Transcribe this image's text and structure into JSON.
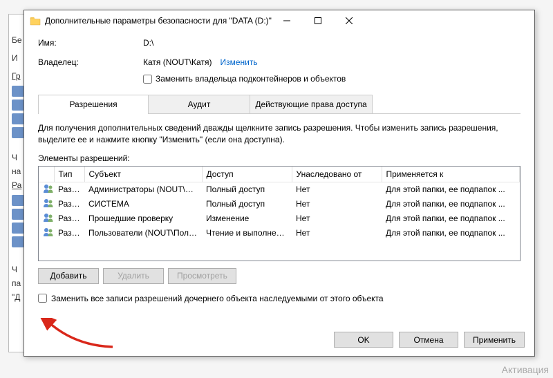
{
  "window": {
    "title": "Дополнительные параметры безопасности  для \"DATA (D:)\""
  },
  "fields": {
    "name_label": "Имя:",
    "name_value": "D:\\",
    "owner_label": "Владелец:",
    "owner_value": "Катя (NOUT\\Катя)",
    "change_link": "Изменить",
    "replace_owner_checkbox": "Заменить владельца подконтейнеров и объектов"
  },
  "tabs": {
    "permissions": "Разрешения",
    "audit": "Аудит",
    "effective": "Действующие права доступа"
  },
  "instructions": "Для получения дополнительных сведений дважды щелкните запись разрешения. Чтобы изменить запись разрешения, выделите ее и нажмите кнопку \"Изменить\" (если она доступна).",
  "section_label": "Элементы разрешений:",
  "columns": {
    "type": "Тип",
    "subject": "Субъект",
    "access": "Доступ",
    "inherited": "Унаследовано от",
    "applies": "Применяется к"
  },
  "rows": [
    {
      "type": "Разр...",
      "subject": "Администраторы (NOUT\\Ад...",
      "access": "Полный доступ",
      "inherited": "Нет",
      "applies": "Для этой папки, ее подпапок ..."
    },
    {
      "type": "Разр...",
      "subject": "СИСТЕМА",
      "access": "Полный доступ",
      "inherited": "Нет",
      "applies": "Для этой папки, ее подпапок ..."
    },
    {
      "type": "Разр...",
      "subject": "Прошедшие проверку",
      "access": "Изменение",
      "inherited": "Нет",
      "applies": "Для этой папки, ее подпапок ..."
    },
    {
      "type": "Разр...",
      "subject": "Пользователи (NOUT\\Польз...",
      "access": "Чтение и выполнение",
      "inherited": "Нет",
      "applies": "Для этой папки, ее подпапок ..."
    }
  ],
  "buttons": {
    "add": "Добавить",
    "remove": "Удалить",
    "view": "Просмотреть",
    "ok": "OK",
    "cancel": "Отмена",
    "apply": "Применить"
  },
  "replace_child_checkbox": "Заменить все записи разрешений дочернего объекта наследуемыми от этого объекта",
  "watermark": "Активация",
  "bg_items": [
    "Бе",
    "И",
    "Гр",
    "Ч",
    "на",
    "Ра",
    "Ч",
    "па",
    "\"Д"
  ]
}
